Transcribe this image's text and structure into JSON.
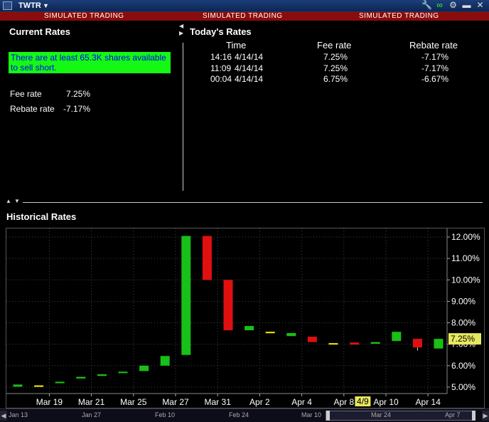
{
  "window": {
    "symbol": "TWTR",
    "sim_banner": [
      "SIMULATED TRADING",
      "SIMULATED TRADING",
      "SIMULATED TRADING"
    ]
  },
  "current_rates": {
    "title": "Current Rates",
    "availability": "There are at least 65.3K shares available to sell short.",
    "fee_label": "Fee rate",
    "fee_value": "7.25%",
    "rebate_label": "Rebate rate",
    "rebate_value": "-7.17%"
  },
  "todays_rates": {
    "title": "Today's Rates",
    "columns": [
      "Time",
      "Fee rate",
      "Rebate rate"
    ],
    "rows": [
      {
        "time": "14:16",
        "date": "4/14/14",
        "fee": "7.25%",
        "rebate": "-7.17%"
      },
      {
        "time": "11:09",
        "date": "4/14/14",
        "fee": "7.25%",
        "rebate": "-7.17%"
      },
      {
        "time": "00:04",
        "date": "4/14/14",
        "fee": "6.75%",
        "rebate": "-6.67%"
      }
    ]
  },
  "historical": {
    "title": "Historical Rates"
  },
  "chart_data": {
    "type": "candlestick",
    "y_ticks": [
      "5.00%",
      "6.00%",
      "7.00%",
      "8.00%",
      "9.00%",
      "10.00%",
      "11.00%",
      "12.00%"
    ],
    "ylim": [
      4.7,
      12.4
    ],
    "x_ticks": [
      {
        "label": "Mar 19",
        "at": 2
      },
      {
        "label": "Mar 21",
        "at": 4
      },
      {
        "label": "Mar 25",
        "at": 6
      },
      {
        "label": "Mar 27",
        "at": 8
      },
      {
        "label": "Mar 31",
        "at": 10
      },
      {
        "label": "Apr 2",
        "at": 12
      },
      {
        "label": "Apr 4",
        "at": 14
      },
      {
        "label": "Apr 8",
        "at": 16
      },
      {
        "label": "Apr 10",
        "at": 18
      },
      {
        "label": "Apr 14",
        "at": 20
      }
    ],
    "candles": [
      {
        "open": 5.02,
        "close": 5.12,
        "color": "#18c018"
      },
      {
        "open": 5.08,
        "close": 5.08,
        "color": "#ffee00"
      },
      {
        "open": 5.18,
        "close": 5.25,
        "color": "#18c018"
      },
      {
        "open": 5.4,
        "close": 5.48,
        "color": "#18c018"
      },
      {
        "open": 5.52,
        "close": 5.6,
        "color": "#18c018"
      },
      {
        "open": 5.65,
        "close": 5.72,
        "color": "#18c018"
      },
      {
        "open": 5.75,
        "close": 6.0,
        "color": "#18c018"
      },
      {
        "open": 6.0,
        "close": 6.45,
        "color": "#18c018"
      },
      {
        "open": 6.5,
        "close": 12.05,
        "color": "#18c018"
      },
      {
        "open": 12.05,
        "close": 10.0,
        "color": "#e01010"
      },
      {
        "open": 10.0,
        "close": 7.65,
        "color": "#e01010"
      },
      {
        "open": 7.65,
        "close": 7.85,
        "color": "#18c018"
      },
      {
        "open": 7.58,
        "close": 7.58,
        "color": "#ffee00"
      },
      {
        "open": 7.38,
        "close": 7.52,
        "color": "#18c018"
      },
      {
        "open": 7.35,
        "close": 7.1,
        "color": "#e01010"
      },
      {
        "open": 7.05,
        "close": 7.05,
        "color": "#ffee00"
      },
      {
        "open": 7.08,
        "close": 6.98,
        "color": "#e01010"
      },
      {
        "open": 7.02,
        "close": 7.1,
        "color": "#18c018"
      },
      {
        "open": 7.15,
        "close": 7.58,
        "color": "#18c018"
      },
      {
        "open": 7.25,
        "close": 6.85,
        "color": "#e01010",
        "low": 6.7
      },
      {
        "open": 6.8,
        "close": 7.25,
        "color": "#18c018"
      }
    ],
    "last_value_label": "7.25%",
    "last_value": 7.25,
    "crosshair_label": "4/9"
  },
  "timeline": {
    "labels": [
      "Jan 13",
      "Jan 27",
      "Feb 10",
      "Feb 24",
      "Mar 10",
      "Mar 24",
      "Apr 7"
    ]
  }
}
